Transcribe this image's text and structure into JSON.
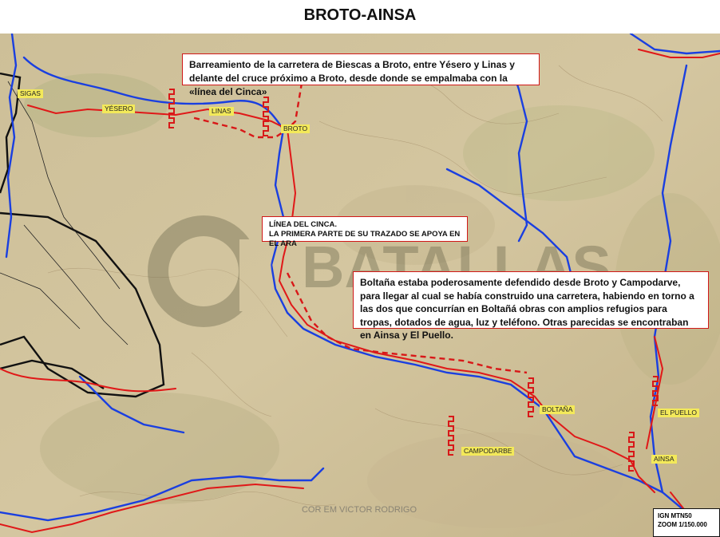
{
  "title": "BROTO-AINSA",
  "callouts": {
    "top": "Barreamiento de la carretera de Biescas a Broto, entre Yésero y Linas y delante del cruce próximo a Broto, desde donde se empalmaba con la  «línea del Cinca»",
    "cinca_line1": "LÍNEA DEL CINCA.",
    "cinca_line2": "LA PRIMERA PARTE DE SU TRAZADO SE APOYA EN EL ARA",
    "boltana": "Boltaña estaba poderosamente defendido desde Broto y  Campodarve, para llegar al cual se había construido una carretera, habiendo en torno a las dos que concurrían en Boltañá obras con amplios refugios para tropas, dotados de agua, luz y teléfono. Otras parecidas se encontraban en Ainsa y El Puello."
  },
  "places": {
    "yesero": "YÉSERO",
    "linas": "LINAS",
    "broto": "BROTO",
    "boltana": "BOLTAÑA",
    "campodarbe": "CAMPODARBE",
    "el_puello": "EL PUELLO",
    "ainsa": "AINSA",
    "sigas": "SIGAS"
  },
  "watermark": "BATALLAS",
  "credit": "COR EM VICTOR RODRIGO",
  "scale": {
    "source": "IGN MTN50",
    "zoom": "ZOOM 1/150.000"
  },
  "colors": {
    "river": "#1a3fe0",
    "road": "#e01818",
    "defense": "#d81818",
    "map_bg": "#cdbf98",
    "callout_border": "#d01818"
  }
}
